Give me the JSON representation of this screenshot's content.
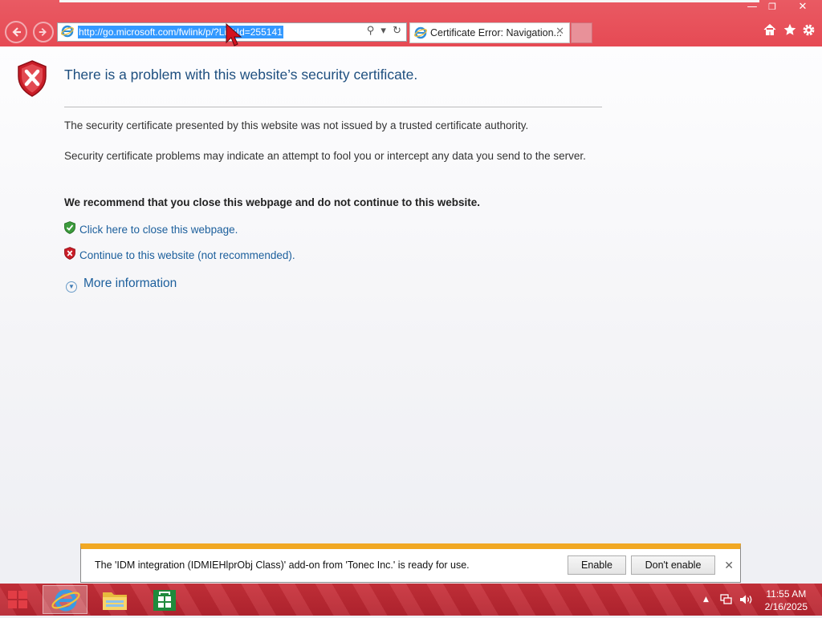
{
  "browser": {
    "address_url": "http://go.microsoft.com/fwlink/p/?LinkId=255141",
    "tab_title": "Certificate Error: Navigation...",
    "tab_close": "✕",
    "window_minimize": "—",
    "window_restore": "❐",
    "window_close": "✕"
  },
  "page": {
    "heading": "There is a problem with this website’s security certificate.",
    "para1": "The security certificate presented by this website was not issued by a trusted certificate authority.",
    "para2": "Security certificate problems may indicate an attempt to fool you or intercept any data you send to the server.",
    "recommend": "We recommend that you close this webpage and do not continue to this website.",
    "close_link": "Click here to close this webpage.",
    "continue_link": "Continue to this website (not recommended).",
    "more_info": "More information"
  },
  "notification": {
    "message": "The 'IDM integration (IDMIEHlprObj Class)' add-on from 'Tonec Inc.' is ready for use.",
    "enable_label": "Enable",
    "dont_enable_label": "Don't enable",
    "close": "✕"
  },
  "taskbar": {
    "time": "11:55 AM",
    "date": "2/16/2025",
    "items": [
      "start-icon",
      "internet-explorer-icon",
      "file-explorer-icon",
      "store-icon"
    ]
  },
  "colors": {
    "chrome": "#e64a54",
    "link": "#1c5f9c",
    "heading": "#1e4f7f",
    "notify_accent": "#f1a823",
    "taskbar": "#c0303a"
  }
}
